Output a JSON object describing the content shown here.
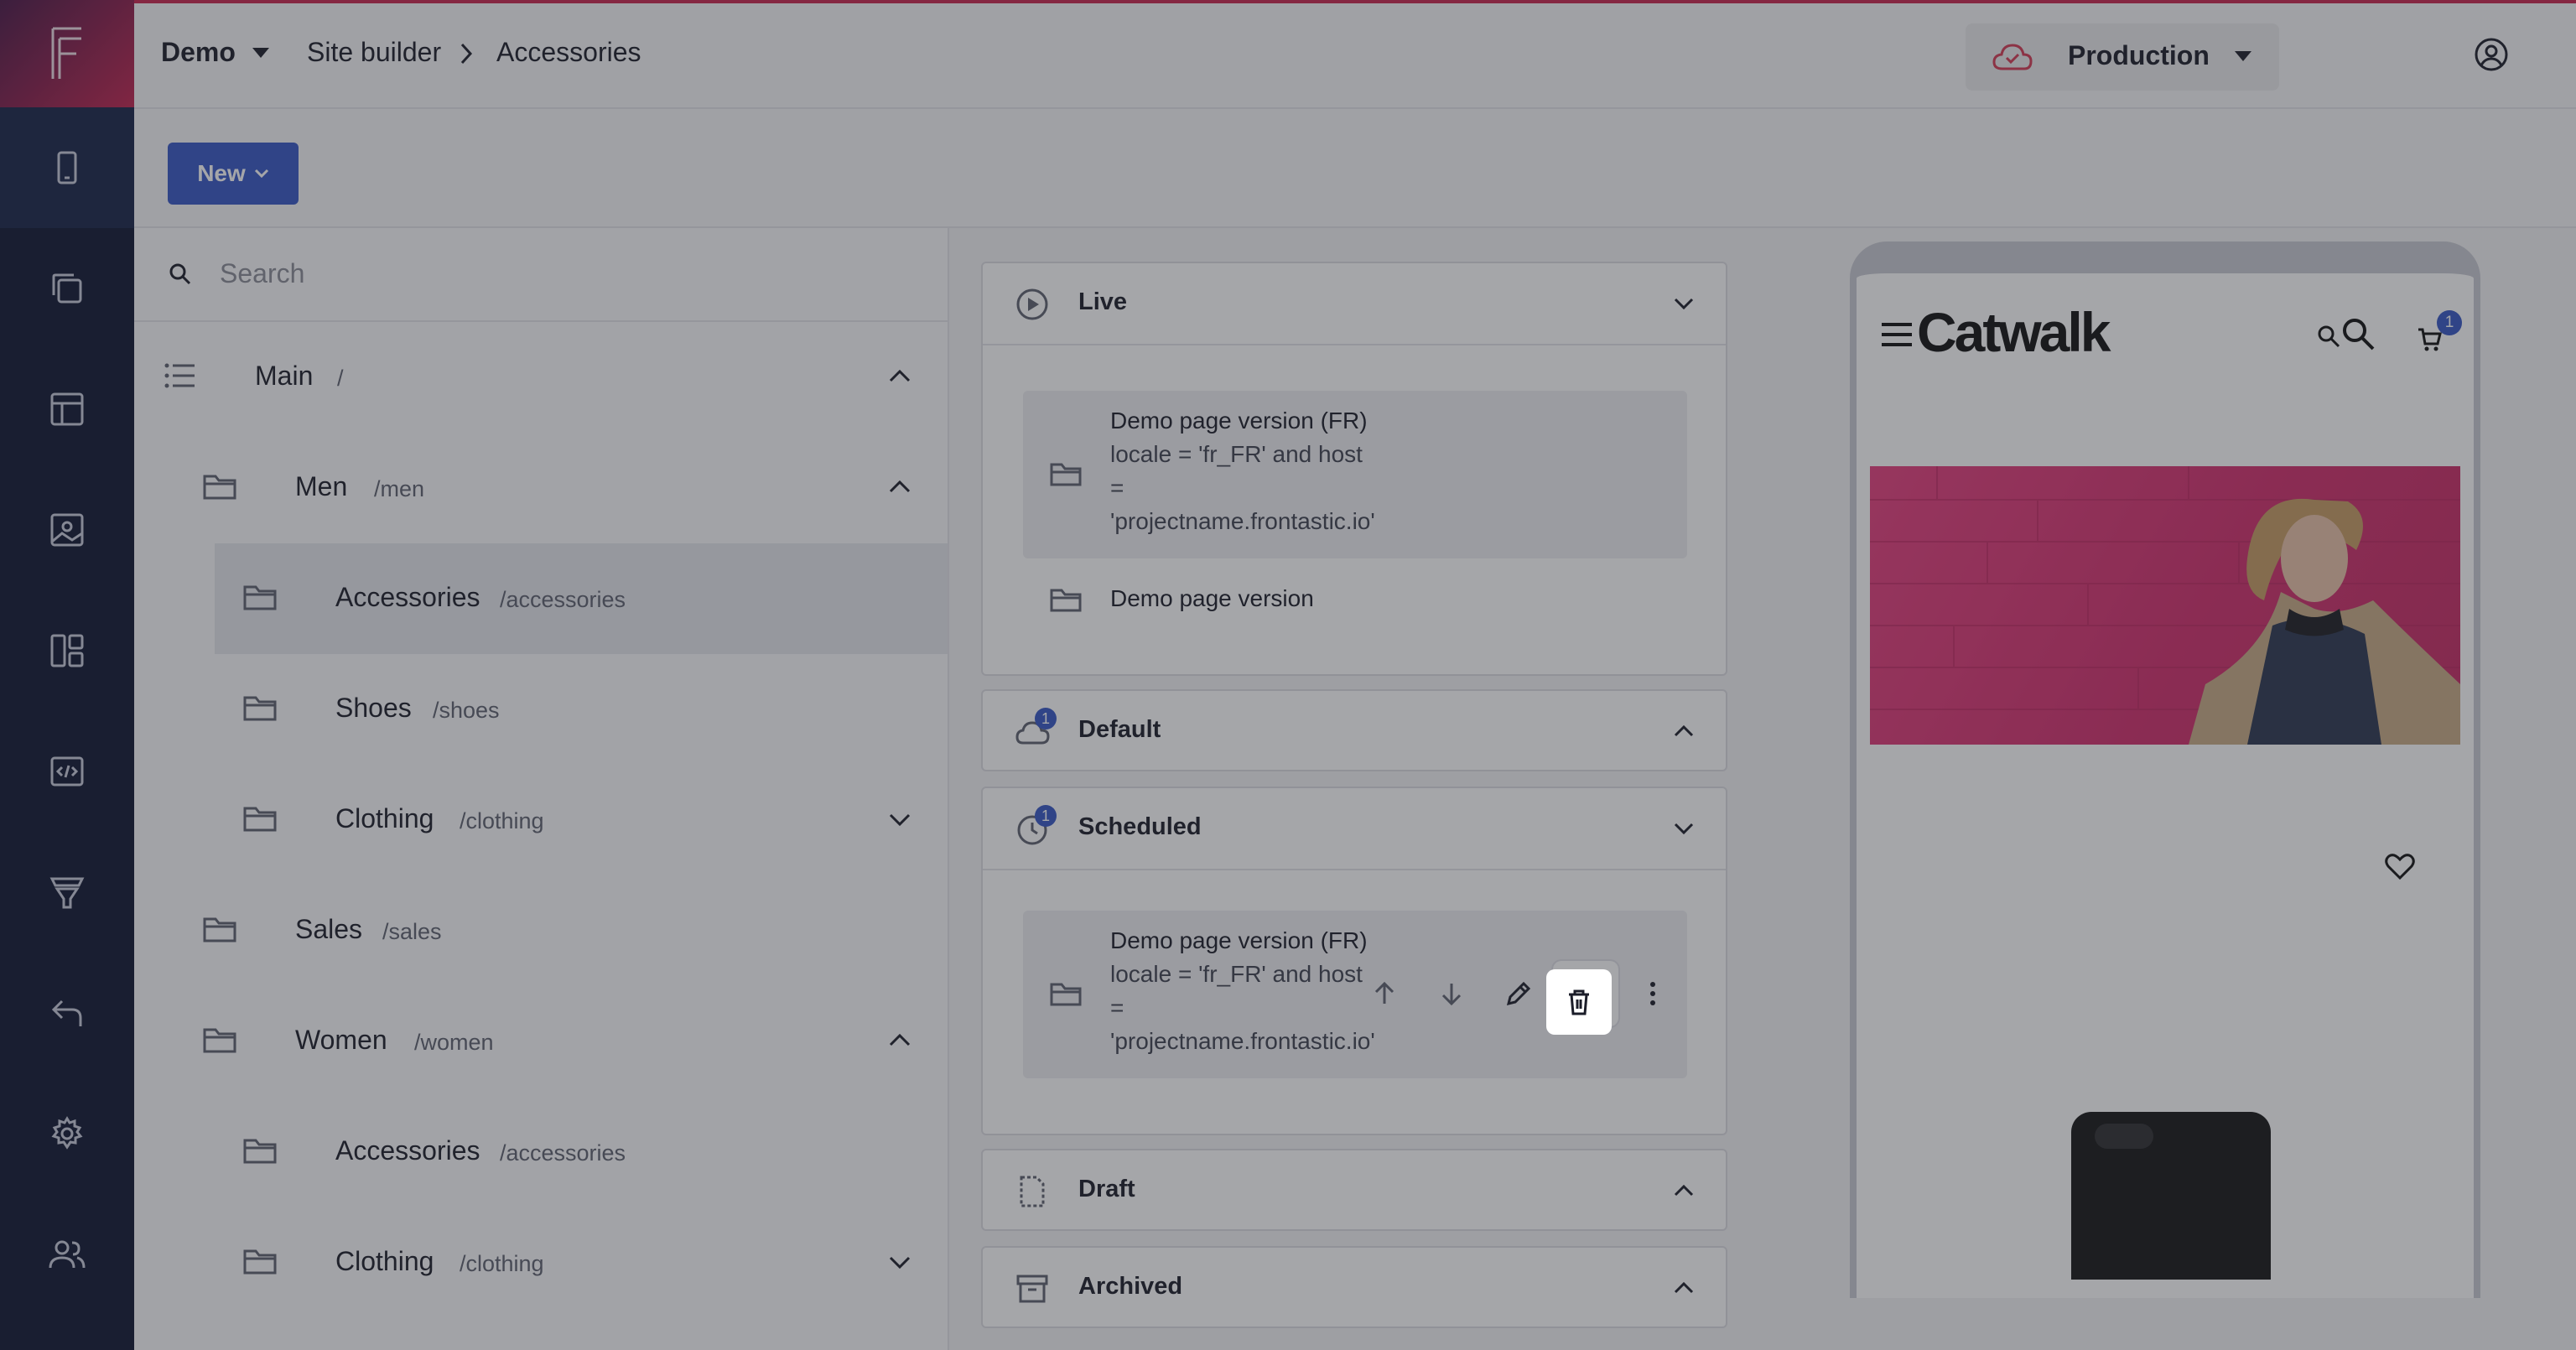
{
  "topbar": {
    "project": "Demo",
    "breadcrumb": [
      "Site builder",
      "Accessories"
    ],
    "environment": "Production"
  },
  "actions": {
    "new_label": "New"
  },
  "tree": {
    "search_placeholder": "Search",
    "rows": [
      {
        "name": "Main",
        "path": "/"
      },
      {
        "name": "Men",
        "path": "/men"
      },
      {
        "name": "Accessories",
        "path": "/accessories"
      },
      {
        "name": "Shoes",
        "path": "/shoes"
      },
      {
        "name": "Clothing",
        "path": "/clothing"
      },
      {
        "name": "Sales",
        "path": "/sales"
      },
      {
        "name": "Women",
        "path": "/women"
      },
      {
        "name": "Accessories",
        "path": "/accessories"
      },
      {
        "name": "Clothing",
        "path": "/clothing"
      }
    ]
  },
  "versions": {
    "live": {
      "title": "Live",
      "items": [
        {
          "name": "Demo page version (FR)",
          "cond1": "locale = 'fr_FR' and host",
          "cond2": "=",
          "cond3": "'projectname.frontastic.io'"
        },
        {
          "name": "Demo page version"
        }
      ]
    },
    "default": {
      "title": "Default",
      "badge": "1"
    },
    "scheduled": {
      "title": "Scheduled",
      "badge": "1",
      "items": [
        {
          "name": "Demo page version (FR)",
          "cond1": "locale = 'fr_FR' and host",
          "cond2": "=",
          "cond3": "'projectname.frontastic.io'"
        }
      ]
    },
    "draft": {
      "title": "Draft"
    },
    "archived": {
      "title": "Archived"
    }
  },
  "preview": {
    "brand": "Catwalk",
    "cart_count": "1"
  }
}
